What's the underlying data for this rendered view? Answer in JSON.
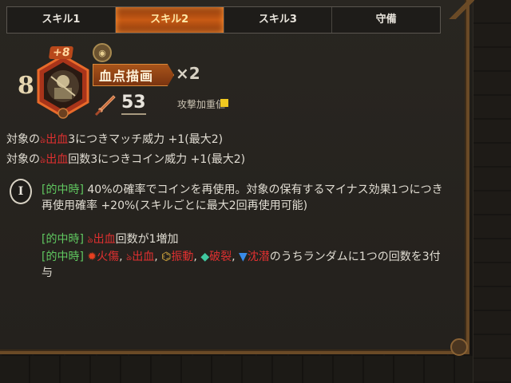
{
  "tabs": [
    {
      "label": "スキル1",
      "active": false
    },
    {
      "label": "スキル2",
      "active": true
    },
    {
      "label": "スキル3",
      "active": false
    },
    {
      "label": "守備",
      "active": false
    }
  ],
  "skill": {
    "level": "8",
    "plus": "+8",
    "name": "血点描画",
    "multiplier": "×2",
    "power": "53",
    "weight_label": "攻撃加重値",
    "icon": "skill-portrait-icon",
    "coin_icon": "coin-icon",
    "weight_color": "#f0c820"
  },
  "effects": [
    {
      "prefix": "対象の",
      "keyword": "出血",
      "suffix": "3につきマッチ威力 +1(最大2)"
    },
    {
      "prefix": "対象の",
      "keyword": "出血",
      "suffix": "回数3につきコイン威力 +1(最大2)"
    }
  ],
  "coin": {
    "index": "I",
    "line1_tag": "[的中時]",
    "line1_text": " 40%の確率でコインを再使用。対象の保有するマイナス効果1つにつき再使用確率 +20%(スキルごとに最大2回再使用可能)",
    "line2_tag": "[的中時]",
    "line2_keyword": "出血",
    "line2_text": "回数が1増加",
    "line3_tag": "[的中時]",
    "line3_k1": "火傷",
    "line3_k2": "出血",
    "line3_k3": "振動",
    "line3_k4": "破裂",
    "line3_k5": "沈潜",
    "line3_sep": ", ",
    "line3_text": "のうちランダムに1つの回数を3付与"
  },
  "colors": {
    "bleed": "#e03030",
    "tag": "#60c860",
    "active_tab": "#c85a14"
  }
}
